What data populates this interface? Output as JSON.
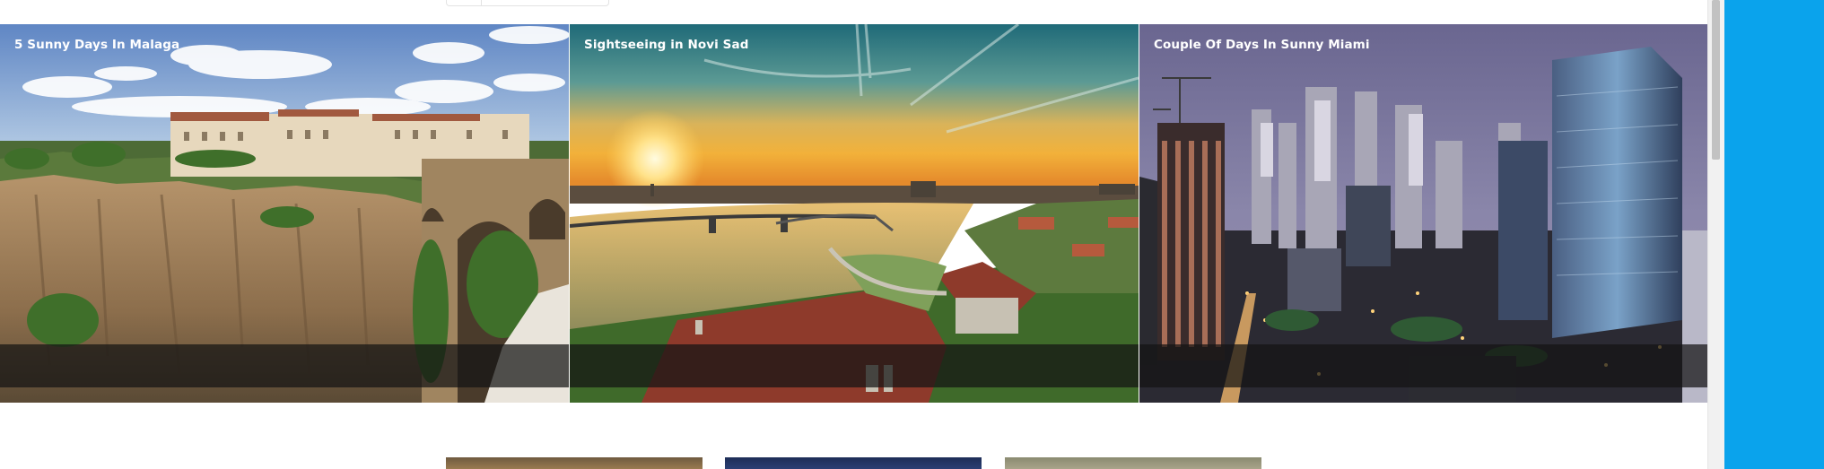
{
  "gallery": {
    "cards": [
      {
        "title": "5 Sunny Days In Malaga",
        "image": "malaga-cliff-bridge-photo"
      },
      {
        "title": "Sightseeing in Novi Sad",
        "image": "novi-sad-river-sunset-photo"
      },
      {
        "title": "Couple Of Days In Sunny Miami",
        "image": "miami-night-skyline-photo"
      }
    ]
  },
  "colors": {
    "side_panel": "#0aa3ec",
    "caption_bg": "rgba(20,20,20,0.72)"
  }
}
